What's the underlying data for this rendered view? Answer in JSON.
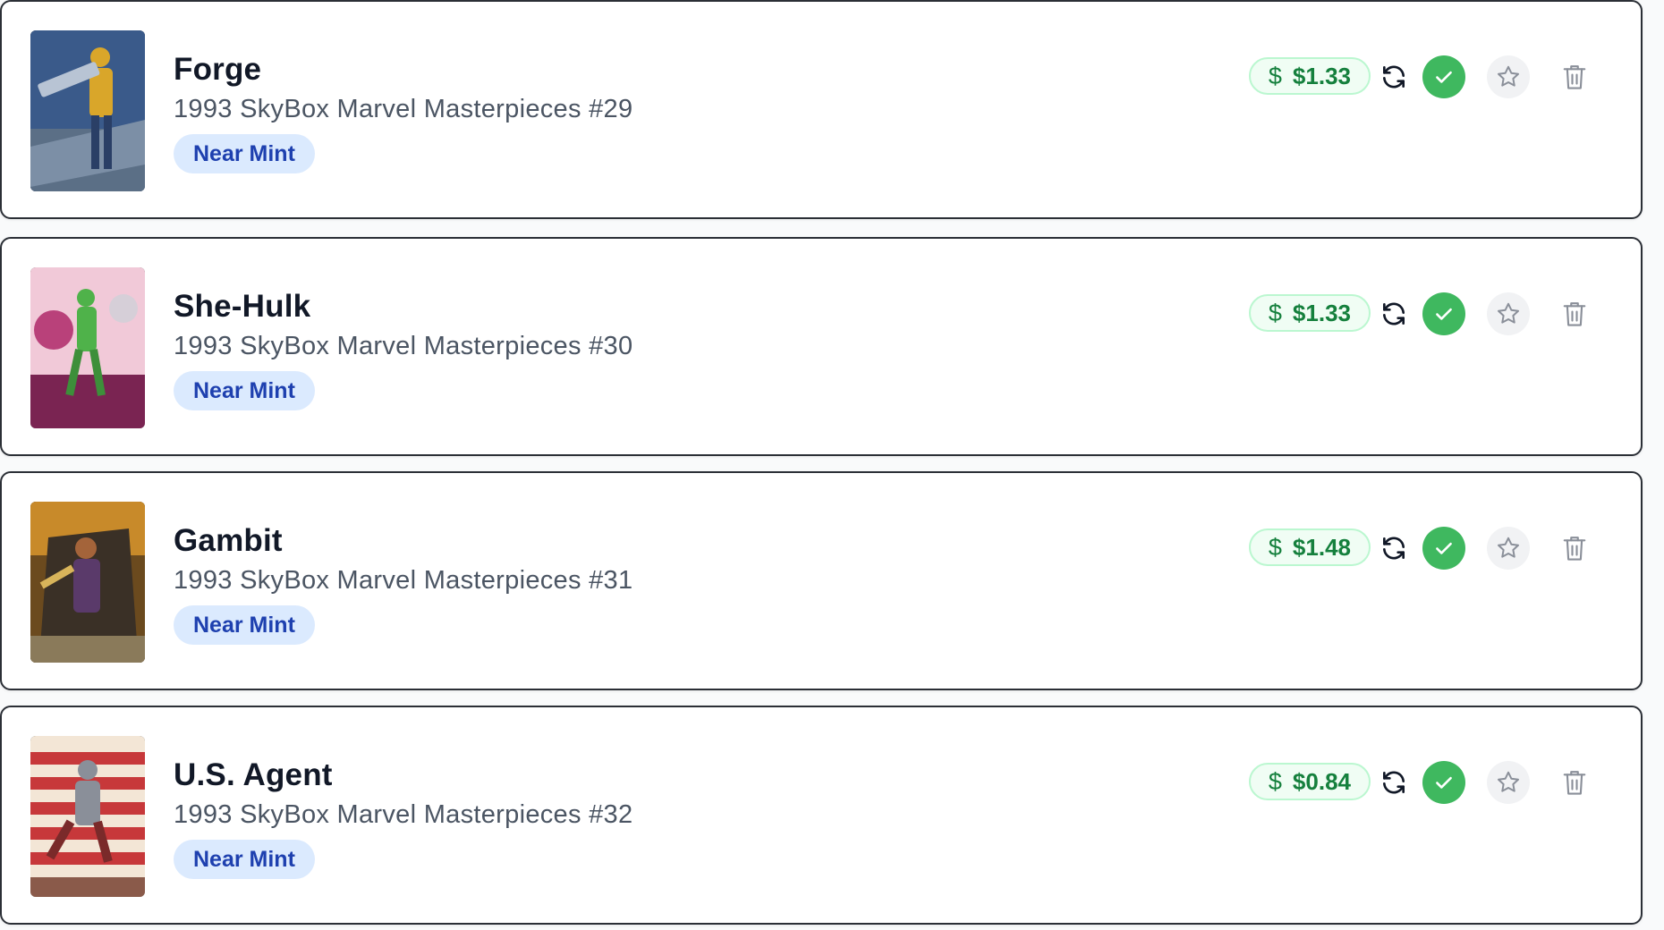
{
  "cards": [
    {
      "title": "Forge",
      "subtitle": "1993 SkyBox Marvel Masterpieces #29",
      "condition": "Near Mint",
      "price_symbol": "$",
      "price": "$1.33",
      "thumb_colors": [
        "#3a5a8a",
        "#d9a62a",
        "#7c8fa6"
      ]
    },
    {
      "title": "She-Hulk",
      "subtitle": "1993 SkyBox Marvel Masterpieces #30",
      "condition": "Near Mint",
      "price_symbol": "$",
      "price": "$1.33",
      "thumb_colors": [
        "#b9417a",
        "#4fb24a",
        "#f1c9d8"
      ]
    },
    {
      "title": "Gambit",
      "subtitle": "1993 SkyBox Marvel Masterpieces #31",
      "condition": "Near Mint",
      "price_symbol": "$",
      "price": "$1.48",
      "thumb_colors": [
        "#6b4a1e",
        "#c88a2a",
        "#3a3026"
      ]
    },
    {
      "title": "U.S. Agent",
      "subtitle": "1993 SkyBox Marvel Masterpieces #32",
      "condition": "Near Mint",
      "price_symbol": "$",
      "price": "$0.84",
      "thumb_colors": [
        "#c7383a",
        "#f3e6d6",
        "#8a8f99"
      ]
    }
  ],
  "icons": {
    "price": "dollar-icon",
    "refresh": "refresh-icon",
    "check": "check-icon",
    "star": "star-icon",
    "delete": "trash-icon"
  },
  "colors": {
    "price_text": "#15803d",
    "badge_bg": "#dbeafe",
    "badge_text": "#1e40af",
    "check_bg": "#3fb85f"
  }
}
